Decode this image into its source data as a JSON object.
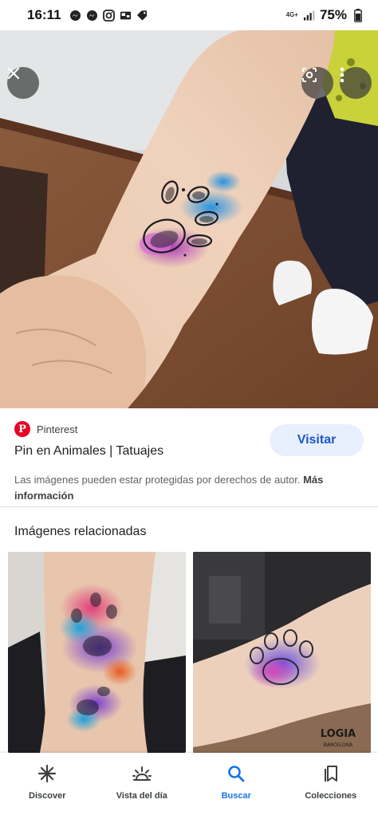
{
  "status_bar": {
    "time": "16:11",
    "network_type": "4G+",
    "battery": "75%"
  },
  "hero": {
    "alt_subject": "watercolor paw print tattoo on wrist"
  },
  "info": {
    "source": "Pinterest",
    "visit_label": "Visitar",
    "title": "Pin en Animales | Tatuajes",
    "copyright_text": "Las imágenes pueden estar protegidas por derechos de autor.",
    "more_info_label": "Más información",
    "related_title": "Imágenes relacionadas"
  },
  "related": {
    "watermark_line1": "LOGIA",
    "watermark_line2": "BARCELONA"
  },
  "bottom_nav": {
    "items": [
      {
        "label": "Discover",
        "icon": "asterisk-icon"
      },
      {
        "label": "Vista del día",
        "icon": "sunrise-icon"
      },
      {
        "label": "Buscar",
        "icon": "search-icon"
      },
      {
        "label": "Colecciones",
        "icon": "bookmarks-icon"
      }
    ],
    "active_index": 2
  },
  "colors": {
    "accent": "#1a73e8",
    "visit_bg": "#e8f0fe",
    "pinterest_red": "#e60023"
  }
}
